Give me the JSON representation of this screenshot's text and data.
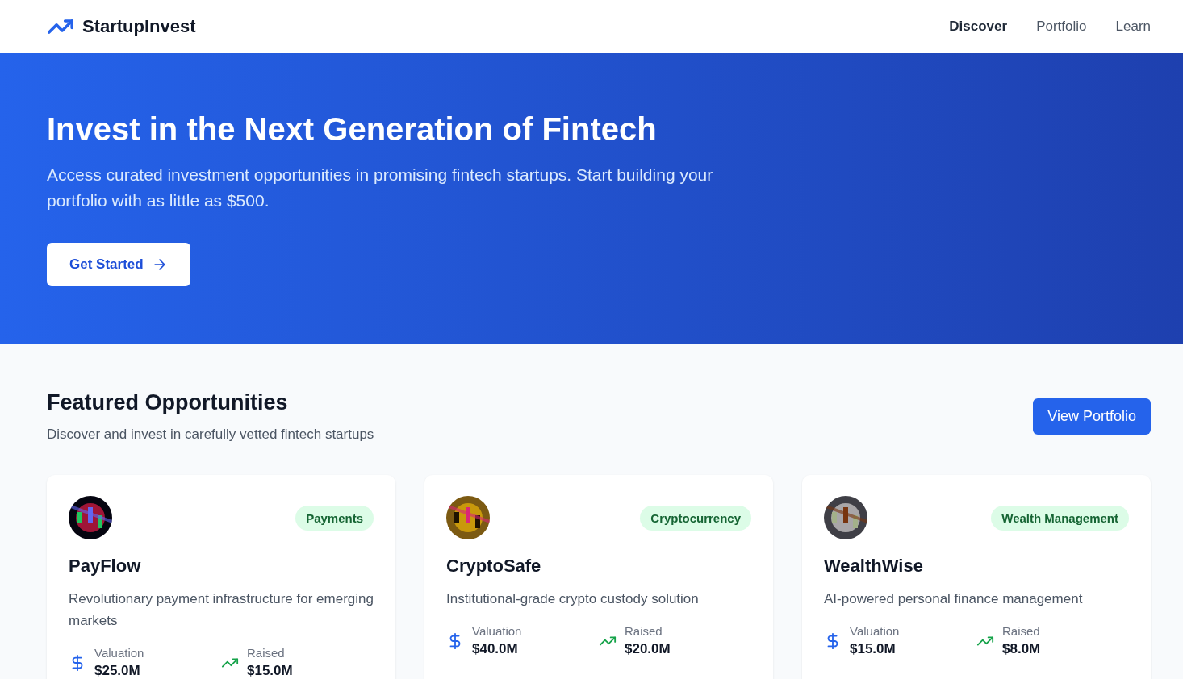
{
  "brand": {
    "name": "StartupInvest"
  },
  "nav": [
    {
      "label": "Discover",
      "selected": true
    },
    {
      "label": "Portfolio",
      "selected": false
    },
    {
      "label": "Learn",
      "selected": false
    }
  ],
  "hero": {
    "title": "Invest in the Next Generation of Fintech",
    "subtitle": "Access curated investment opportunities in promising fintech startups. Start building your portfolio with as little as $500.",
    "button": "Get Started"
  },
  "featured": {
    "title": "Featured Opportunities",
    "subtitle": "Discover and invest in carefully vetted fintech startups",
    "button": "View Portfolio"
  },
  "cards": [
    {
      "name": "PayFlow",
      "tag": "Payments",
      "description": "Revolutionary payment infrastructure for emerging markets",
      "picture": {
        "kind": "picture"
      },
      "metrics": [
        {
          "kind": "valuation",
          "label": "Valuation",
          "value": "$25.0M"
        },
        {
          "kind": "raised",
          "label": "Raised",
          "value": "$15.0M"
        }
      ]
    },
    {
      "name": "CryptoSafe",
      "tag": "Cryptocurrency",
      "description": "Institutional-grade crypto custody solution",
      "picture": {
        "kind": "picture"
      },
      "metrics": [
        {
          "kind": "valuation",
          "label": "Valuation",
          "value": "$40.0M"
        },
        {
          "kind": "raised",
          "label": "Raised",
          "value": "$20.0M"
        }
      ]
    },
    {
      "name": "WealthWise",
      "tag": "Wealth Management",
      "description": "AI-powered personal finance management",
      "picture": {
        "kind": "picture"
      },
      "metrics": [
        {
          "kind": "valuation",
          "label": "Valuation",
          "value": "$15.0M"
        },
        {
          "kind": "raised",
          "label": "Raised",
          "value": "$8.0M"
        }
      ]
    }
  ]
}
